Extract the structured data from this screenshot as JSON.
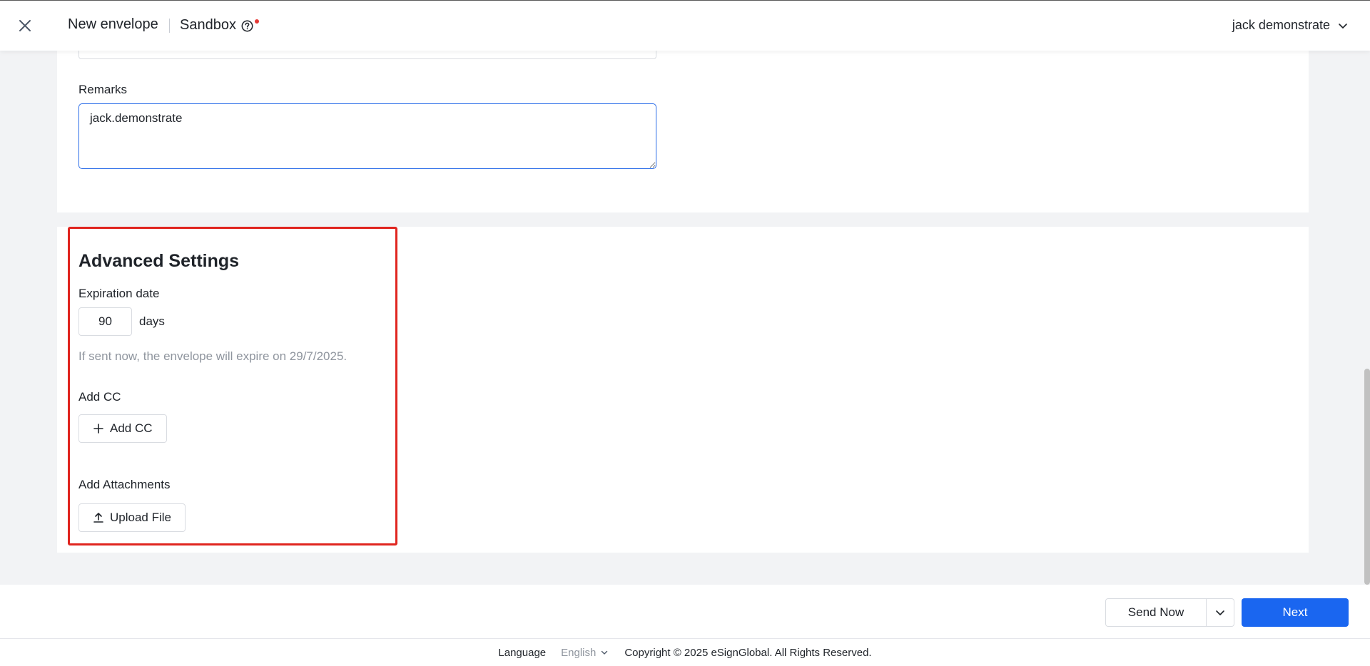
{
  "header": {
    "title": "New envelope",
    "environment": "Sandbox",
    "user_name": "jack demonstrate"
  },
  "remarks": {
    "label": "Remarks",
    "value": "jack.demonstrate"
  },
  "advanced": {
    "title": "Advanced Settings",
    "expiration_label": "Expiration date",
    "expiration_value": "90",
    "days_label": "days",
    "hint": "If sent now, the envelope will expire on 29/7/2025.",
    "cc_label": "Add CC",
    "cc_button": "Add CC",
    "attachments_label": "Add Attachments",
    "upload_button": "Upload File"
  },
  "actions": {
    "send_now": "Send Now",
    "next": "Next"
  },
  "footer": {
    "language_label": "Language",
    "language_value": "English",
    "copyright": "Copyright © 2025 eSignGlobal. All Rights Reserved."
  },
  "colors": {
    "primary": "#1a66f0",
    "highlight": "#e0251f",
    "focus_border": "#2b6de8",
    "hint_text": "#8f959e"
  },
  "icons": [
    "close-icon",
    "help-icon",
    "chevron-down-icon",
    "plus-icon",
    "upload-icon"
  ]
}
